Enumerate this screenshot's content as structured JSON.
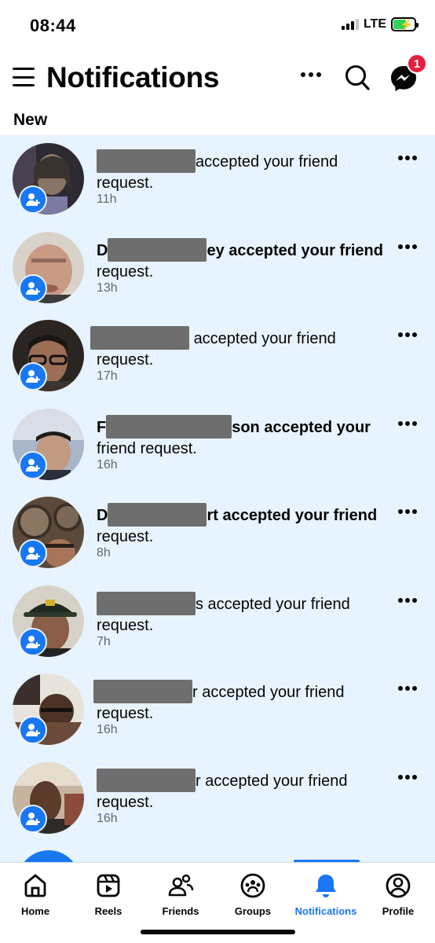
{
  "status_bar": {
    "time": "08:44",
    "network": "LTE",
    "battery_level": 0.6
  },
  "header": {
    "title": "Notifications",
    "badge_count": "1"
  },
  "section": {
    "label": "New"
  },
  "notifications": [
    {
      "prefix": "",
      "suffix": "accepted your friend",
      "line2": "request.",
      "time": "11h"
    },
    {
      "prefix": "D",
      "suffix": "ey accepted your friend",
      "line2": "request.",
      "time": "13h"
    },
    {
      "prefix": "",
      "suffix": "accepted your friend",
      "line2": "request.",
      "time": "17h"
    },
    {
      "prefix": "F",
      "suffix": "son accepted your",
      "line2": "friend request.",
      "time": "16h"
    },
    {
      "prefix": "D",
      "suffix": "rt accepted your friend",
      "line2": "request.",
      "time": "8h"
    },
    {
      "prefix": "",
      "suffix": "s accepted your friend",
      "line2": "request.",
      "time": "7h"
    },
    {
      "prefix": "",
      "suffix": "r accepted your friend",
      "line2": "request.",
      "time": "16h"
    },
    {
      "prefix": "",
      "suffix": "r accepted your friend",
      "line2": "request.",
      "time": "16h"
    }
  ],
  "tabs": [
    {
      "label": "Home",
      "icon": "home-icon"
    },
    {
      "label": "Reels",
      "icon": "reels-icon"
    },
    {
      "label": "Friends",
      "icon": "friends-icon"
    },
    {
      "label": "Groups",
      "icon": "groups-icon"
    },
    {
      "label": "Notifications",
      "icon": "bell-icon",
      "active": true
    },
    {
      "label": "Profile",
      "icon": "profile-icon"
    }
  ],
  "colors": {
    "accent": "#1877f2",
    "unread_bg": "#e7f3ff",
    "badge": "#e41e3f",
    "secondary_text": "#65676b"
  }
}
